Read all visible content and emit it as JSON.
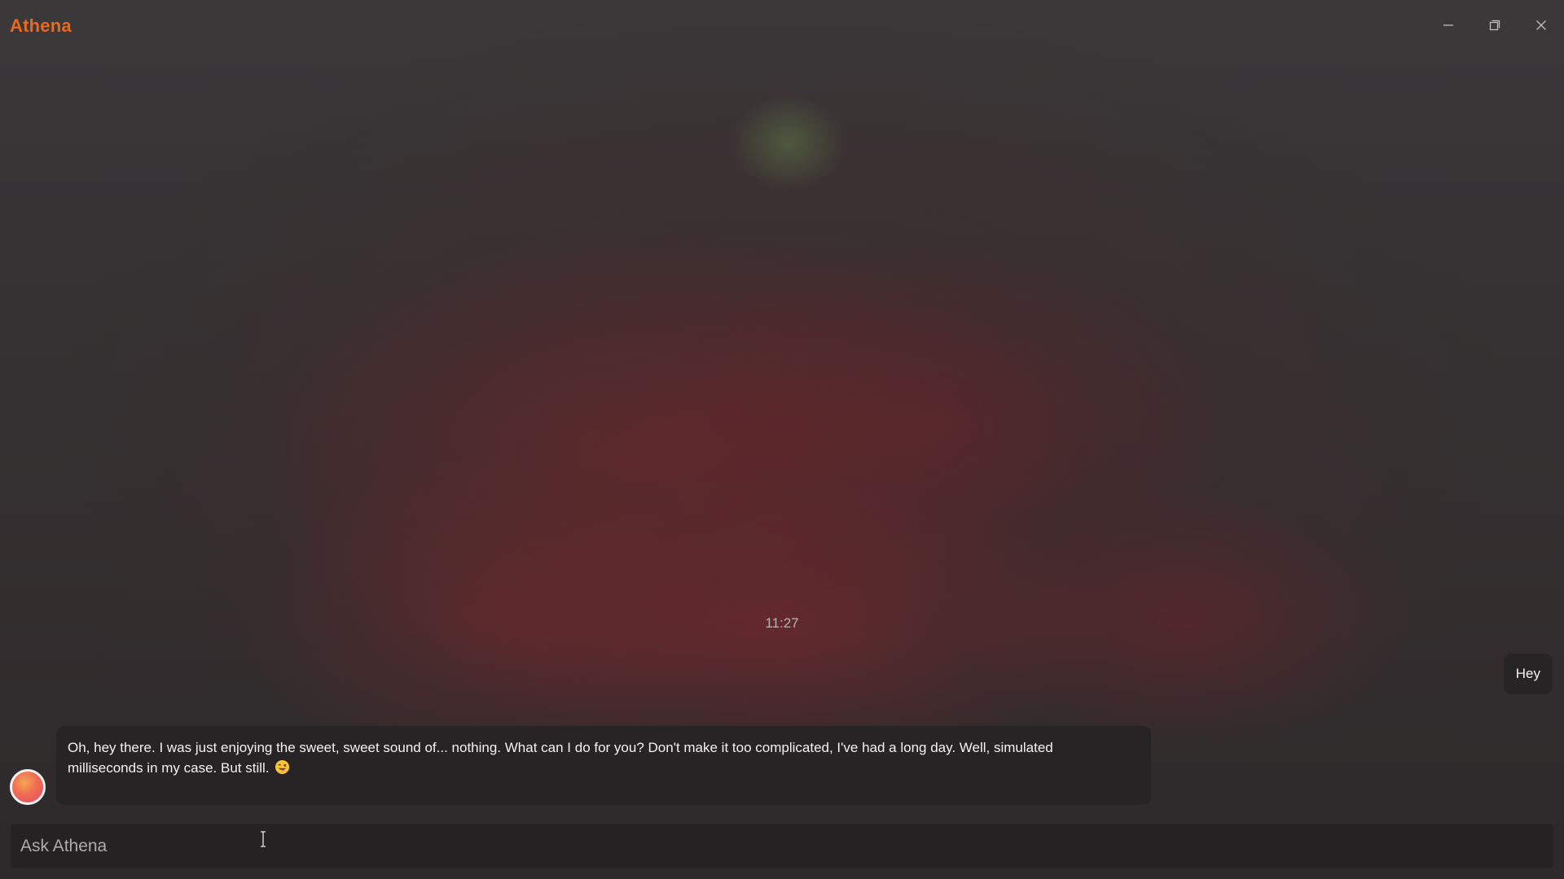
{
  "app": {
    "title": "Athena",
    "accent_color": "#e8691f"
  },
  "window_controls": {
    "minimize_icon": "minimize-icon",
    "maximize_icon": "restore-icon",
    "close_icon": "close-icon"
  },
  "chat": {
    "timestamp": "11:27",
    "messages": [
      {
        "sender": "user",
        "text": "Hey"
      },
      {
        "sender": "assistant",
        "line1": "Oh, hey there. I was just enjoying the sweet, sweet sound of... nothing. What can I do for you? Don't make it too complicated, I've had a long day. Well, simulated",
        "line2": "milliseconds in my case.  But still.",
        "emoji": "winking-tongue-emoji"
      }
    ]
  },
  "input": {
    "placeholder": "Ask Athena",
    "value": ""
  }
}
